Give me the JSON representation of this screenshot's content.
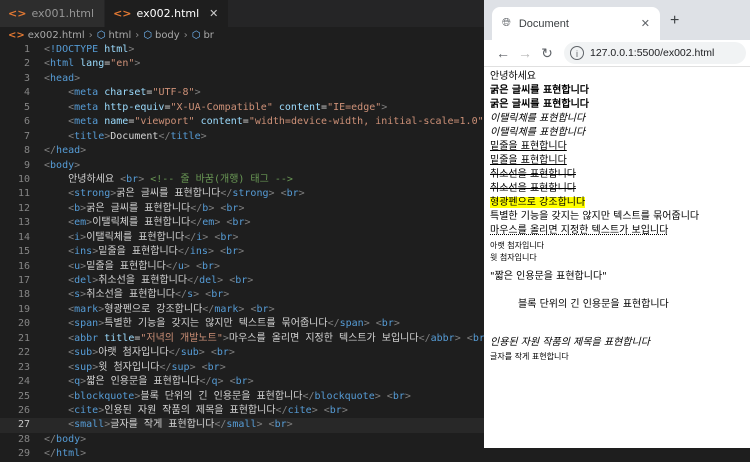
{
  "editor": {
    "tabs": [
      {
        "label": "ex001.html",
        "active": false
      },
      {
        "label": "ex002.html",
        "active": true
      }
    ],
    "breadcrumb": {
      "file": "ex002.html",
      "items": [
        "html",
        "body",
        "br"
      ]
    },
    "lines": [
      {
        "n": "1",
        "html": "<span class=\"p\">&lt;</span><span class=\"t\">!DOCTYPE</span> <span class=\"a\">html</span><span class=\"p\">&gt;</span>"
      },
      {
        "n": "2",
        "html": "<span class=\"p\">&lt;</span><span class=\"t\">html</span> <span class=\"a\">lang</span>=<span class=\"s\">\"en\"</span><span class=\"p\">&gt;</span>"
      },
      {
        "n": "3",
        "html": "<span class=\"p\">&lt;</span><span class=\"t\">head</span><span class=\"p\">&gt;</span>"
      },
      {
        "n": "4",
        "html": "    <span class=\"p\">&lt;</span><span class=\"t\">meta</span> <span class=\"a\">charset</span>=<span class=\"s\">\"UTF-8\"</span><span class=\"p\">&gt;</span>"
      },
      {
        "n": "5",
        "html": "    <span class=\"p\">&lt;</span><span class=\"t\">meta</span> <span class=\"a\">http-equiv</span>=<span class=\"s\">\"X-UA-Compatible\"</span> <span class=\"a\">content</span>=<span class=\"s\">\"IE=edge\"</span><span class=\"p\">&gt;</span>"
      },
      {
        "n": "6",
        "html": "    <span class=\"p\">&lt;</span><span class=\"t\">meta</span> <span class=\"a\">name</span>=<span class=\"s\">\"viewport\"</span> <span class=\"a\">content</span>=<span class=\"s\">\"width=device-width, initial-scale=1.0\"</span><span class=\"p\">&gt;</span>"
      },
      {
        "n": "7",
        "html": "    <span class=\"p\">&lt;</span><span class=\"t\">title</span><span class=\"p\">&gt;</span>Document<span class=\"p\">&lt;/</span><span class=\"t\">title</span><span class=\"p\">&gt;</span>"
      },
      {
        "n": "8",
        "html": "<span class=\"p\">&lt;/</span><span class=\"t\">head</span><span class=\"p\">&gt;</span>"
      },
      {
        "n": "9",
        "html": "<span class=\"p\">&lt;</span><span class=\"t\">body</span><span class=\"p\">&gt;</span>"
      },
      {
        "n": "10",
        "html": "    안녕하세요 <span class=\"p\">&lt;</span><span class=\"t\">br</span><span class=\"p\">&gt;</span> <span class=\"c\">&lt;!-- 줄 바꿈(개행) 태그 --&gt;</span>"
      },
      {
        "n": "11",
        "html": "    <span class=\"p\">&lt;</span><span class=\"t\">strong</span><span class=\"p\">&gt;</span>굵은 글씨를 표현합니다<span class=\"p\">&lt;/</span><span class=\"t\">strong</span><span class=\"p\">&gt;</span> <span class=\"p\">&lt;</span><span class=\"t\">br</span><span class=\"p\">&gt;</span>"
      },
      {
        "n": "12",
        "html": "    <span class=\"p\">&lt;</span><span class=\"t\">b</span><span class=\"p\">&gt;</span>굵은 글씨를 표현합니다<span class=\"p\">&lt;/</span><span class=\"t\">b</span><span class=\"p\">&gt;</span> <span class=\"p\">&lt;</span><span class=\"t\">br</span><span class=\"p\">&gt;</span>"
      },
      {
        "n": "13",
        "html": "    <span class=\"p\">&lt;</span><span class=\"t\">em</span><span class=\"p\">&gt;</span>이탤릭체를 표현합니다<span class=\"p\">&lt;/</span><span class=\"t\">em</span><span class=\"p\">&gt;</span> <span class=\"p\">&lt;</span><span class=\"t\">br</span><span class=\"p\">&gt;</span>"
      },
      {
        "n": "14",
        "html": "    <span class=\"p\">&lt;</span><span class=\"t\">i</span><span class=\"p\">&gt;</span>이탤릭체를 표현합니다<span class=\"p\">&lt;/</span><span class=\"t\">i</span><span class=\"p\">&gt;</span> <span class=\"p\">&lt;</span><span class=\"t\">br</span><span class=\"p\">&gt;</span>"
      },
      {
        "n": "15",
        "html": "    <span class=\"p\">&lt;</span><span class=\"t\">ins</span><span class=\"p\">&gt;</span>밑줄을 표현합니다<span class=\"p\">&lt;/</span><span class=\"t\">ins</span><span class=\"p\">&gt;</span> <span class=\"p\">&lt;</span><span class=\"t\">br</span><span class=\"p\">&gt;</span>"
      },
      {
        "n": "16",
        "html": "    <span class=\"p\">&lt;</span><span class=\"t\">u</span><span class=\"p\">&gt;</span>밑줄을 표현합니다<span class=\"p\">&lt;/</span><span class=\"t\">u</span><span class=\"p\">&gt;</span> <span class=\"p\">&lt;</span><span class=\"t\">br</span><span class=\"p\">&gt;</span>"
      },
      {
        "n": "17",
        "html": "    <span class=\"p\">&lt;</span><span class=\"t\">del</span><span class=\"p\">&gt;</span>취소선을 표현합니다<span class=\"p\">&lt;/</span><span class=\"t\">del</span><span class=\"p\">&gt;</span> <span class=\"p\">&lt;</span><span class=\"t\">br</span><span class=\"p\">&gt;</span>"
      },
      {
        "n": "18",
        "html": "    <span class=\"p\">&lt;</span><span class=\"t\">s</span><span class=\"p\">&gt;</span>취소선을 표현합니다<span class=\"p\">&lt;/</span><span class=\"t\">s</span><span class=\"p\">&gt;</span> <span class=\"p\">&lt;</span><span class=\"t\">br</span><span class=\"p\">&gt;</span>"
      },
      {
        "n": "19",
        "html": "    <span class=\"p\">&lt;</span><span class=\"t\">mark</span><span class=\"p\">&gt;</span>형광펜으로 강조합니다<span class=\"p\">&lt;/</span><span class=\"t\">mark</span><span class=\"p\">&gt;</span> <span class=\"p\">&lt;</span><span class=\"t\">br</span><span class=\"p\">&gt;</span>"
      },
      {
        "n": "20",
        "html": "    <span class=\"p\">&lt;</span><span class=\"t\">span</span><span class=\"p\">&gt;</span>특별한 기능을 갖지는 않지만 텍스트를 묶어줍니다<span class=\"p\">&lt;/</span><span class=\"t\">span</span><span class=\"p\">&gt;</span> <span class=\"p\">&lt;</span><span class=\"t\">br</span><span class=\"p\">&gt;</span>"
      },
      {
        "n": "21",
        "html": "    <span class=\"p\">&lt;</span><span class=\"t\">abbr</span> <span class=\"a\">title</span>=<span class=\"s\">\"저녁의 개발노트\"</span><span class=\"p\">&gt;</span>마우스를 올리면 지정한 텍스트가 보입니다<span class=\"p\">&lt;/</span><span class=\"t\">abbr</span><span class=\"p\">&gt;</span> <span class=\"p\">&lt;</span><span class=\"t\">br</span><span class=\"p\">&gt;</span>"
      },
      {
        "n": "22",
        "html": "    <span class=\"p\">&lt;</span><span class=\"t\">sub</span><span class=\"p\">&gt;</span>아랫 첨자입니다<span class=\"p\">&lt;/</span><span class=\"t\">sub</span><span class=\"p\">&gt;</span> <span class=\"p\">&lt;</span><span class=\"t\">br</span><span class=\"p\">&gt;</span>"
      },
      {
        "n": "23",
        "html": "    <span class=\"p\">&lt;</span><span class=\"t\">sup</span><span class=\"p\">&gt;</span>윗 첨자입니다<span class=\"p\">&lt;/</span><span class=\"t\">sup</span><span class=\"p\">&gt;</span> <span class=\"p\">&lt;</span><span class=\"t\">br</span><span class=\"p\">&gt;</span>"
      },
      {
        "n": "24",
        "html": "    <span class=\"p\">&lt;</span><span class=\"t\">q</span><span class=\"p\">&gt;</span>짧은 인용문을 표현합니다<span class=\"p\">&lt;/</span><span class=\"t\">q</span><span class=\"p\">&gt;</span> <span class=\"p\">&lt;</span><span class=\"t\">br</span><span class=\"p\">&gt;</span>"
      },
      {
        "n": "25",
        "html": "    <span class=\"p\">&lt;</span><span class=\"t\">blockquote</span><span class=\"p\">&gt;</span>블록 단위의 긴 인용문을 표현합니다<span class=\"p\">&lt;/</span><span class=\"t\">blockquote</span><span class=\"p\">&gt;</span> <span class=\"p\">&lt;</span><span class=\"t\">br</span><span class=\"p\">&gt;</span>"
      },
      {
        "n": "26",
        "html": "    <span class=\"p\">&lt;</span><span class=\"t\">cite</span><span class=\"p\">&gt;</span>인용된 자원 작품의 제목을 표현합니다<span class=\"p\">&lt;/</span><span class=\"t\">cite</span><span class=\"p\">&gt;</span> <span class=\"p\">&lt;</span><span class=\"t\">br</span><span class=\"p\">&gt;</span>"
      },
      {
        "n": "27",
        "html": "    <span class=\"p\">&lt;</span><span class=\"t\">small</span><span class=\"p\">&gt;</span>글자를 작게 표현합니다<span class=\"p\">&lt;/</span><span class=\"t\">small</span><span class=\"p\">&gt;</span> <span class=\"p\">&lt;</span><span class=\"t\">br</span><span class=\"p\">&gt;</span>"
      },
      {
        "n": "28",
        "html": "<span class=\"p\">&lt;/</span><span class=\"t\">body</span><span class=\"p\">&gt;</span>"
      },
      {
        "n": "29",
        "html": "<span class=\"p\">&lt;/</span><span class=\"t\">html</span><span class=\"p\">&gt;</span>"
      }
    ],
    "current_line": "27"
  },
  "browser": {
    "tab_title": "Document",
    "url": "127.0.0.1:5500/ex002.html",
    "icons": [
      "globe-icon",
      "close-icon",
      "new-tab-icon",
      "back-icon",
      "forward-icon",
      "reload-icon",
      "info-icon"
    ],
    "content": {
      "hello": "안녕하세요",
      "strong": "굵은 글씨를 표현합니다",
      "b": "굵은 글씨를 표현합니다",
      "em": "이탤릭체를 표현합니다",
      "i": "이탤릭체를 표현합니다",
      "ins": "밑줄을 표현합니다",
      "u": "밑줄을 표현합니다",
      "del": "취소선을 표현합니다",
      "s": "취소선을 표현합니다",
      "mark": "형광펜으로 강조합니다",
      "span": "특별한 기능을 갖지는 않지만 텍스트를 묶어줍니다",
      "abbr": "마우스를 올리면 지정한 텍스트가 보입니다",
      "sub": "아랫 첨자입니다",
      "sup": "윗 첨자입니다",
      "q": "\"짧은 인용문을 표현합니다\"",
      "blockquote": "블록 단위의 긴 인용문을 표현합니다",
      "cite": "인용된 자원 작품의 제목을 표현합니다",
      "small": "글자를 작게 표현합니다"
    },
    "mark_color": "#ffff00"
  }
}
